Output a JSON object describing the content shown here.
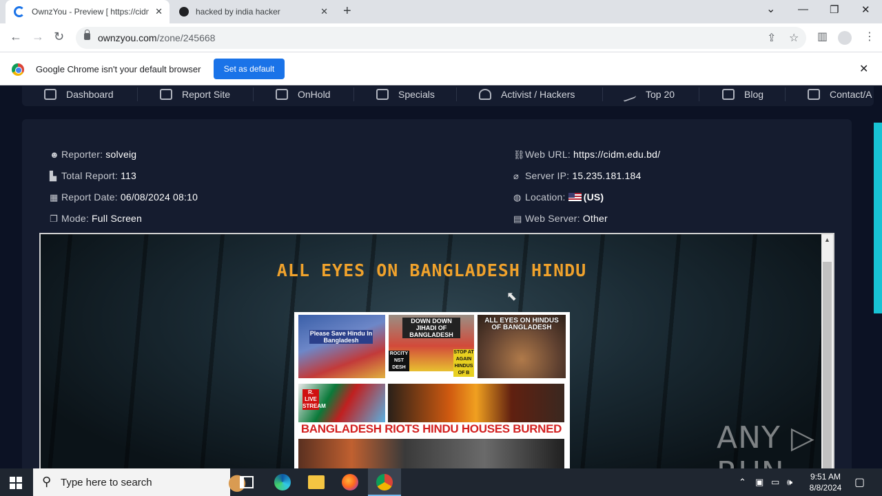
{
  "browser": {
    "tabs": [
      {
        "title": "OwnzYou - Preview [ https://cidm",
        "active": true
      },
      {
        "title": "hacked by india hacker",
        "active": false
      }
    ],
    "new_tab": "+",
    "window_controls": {
      "minimize": "—",
      "restore": "❐",
      "close": "✕",
      "tab_search": "⌄"
    },
    "url_host": "ownzyou.com",
    "url_path": "/zone/245668",
    "infobar": {
      "message": "Google Chrome isn't your default browser",
      "button": "Set as default",
      "close": "✕"
    },
    "icons": {
      "back": "back-arrow-icon",
      "forward": "forward-arrow-icon",
      "reload": "reload-icon",
      "lock": "lock-icon",
      "share": "share-icon",
      "star": "star-icon",
      "sidepanel": "side-panel-icon",
      "profile": "profile-icon",
      "menu": "kebab-menu-icon"
    }
  },
  "site": {
    "nav": [
      {
        "label": "Dashboard",
        "icon": "home-icon"
      },
      {
        "label": "Report Site",
        "icon": "plus-square-icon"
      },
      {
        "label": "OnHold",
        "icon": "inbox-icon"
      },
      {
        "label": "Specials",
        "icon": "square-icon"
      },
      {
        "label": "Activist / Hackers",
        "icon": "users-icon"
      },
      {
        "label": "Top 20",
        "icon": "trend-icon"
      },
      {
        "label": "Blog",
        "icon": "document-icon"
      },
      {
        "label": "Contact/A",
        "icon": "mail-icon"
      }
    ],
    "meta_left": [
      {
        "label": "Reporter:",
        "value": "solveig",
        "icon": "user-secret-icon"
      },
      {
        "label": "Total Report:",
        "value": "113",
        "icon": "bar-chart-icon"
      },
      {
        "label": "Report Date:",
        "value": "06/08/2024 08:10",
        "icon": "calendar-icon"
      },
      {
        "label": "Mode:",
        "value": "Full Screen",
        "icon": "window-icon"
      }
    ],
    "meta_right": [
      {
        "label": "Web URL:",
        "value": "https://cidm.edu.bd/",
        "icon": "link-icon"
      },
      {
        "label": "Server IP:",
        "value": "15.235.181.184",
        "icon": "paperclip-icon"
      },
      {
        "label": "Location:",
        "value": "(US)",
        "icon": "globe-icon"
      },
      {
        "label": "Web Server:",
        "value": "Other",
        "icon": "server-icon"
      }
    ],
    "preview": {
      "title": "ALL EYES ON BANGLADESH HINDU",
      "banner": "BANGLADESH RIOTS HINDU HOUSES BURNED",
      "captions": {
        "sign": "Please Save Hindu In Bangladesh",
        "protest": "DOWN DOWN JIHADI OF BANGLADESH",
        "stop": "STOP AT AGAIN HINDUS OF B",
        "aeo": "ALL EYES ON HINDUS OF BANGLADESH",
        "live": "R. LIVE STREAM",
        "atrocity": "ROCITY NST DESH"
      }
    },
    "watermark": "ANY ▷ RUN"
  },
  "taskbar": {
    "search_placeholder": "Type here to search",
    "time": "9:51 AM",
    "date": "8/8/2024",
    "apps": [
      "task-view-icon",
      "edge-icon",
      "file-explorer-icon",
      "firefox-icon",
      "chrome-icon"
    ]
  }
}
